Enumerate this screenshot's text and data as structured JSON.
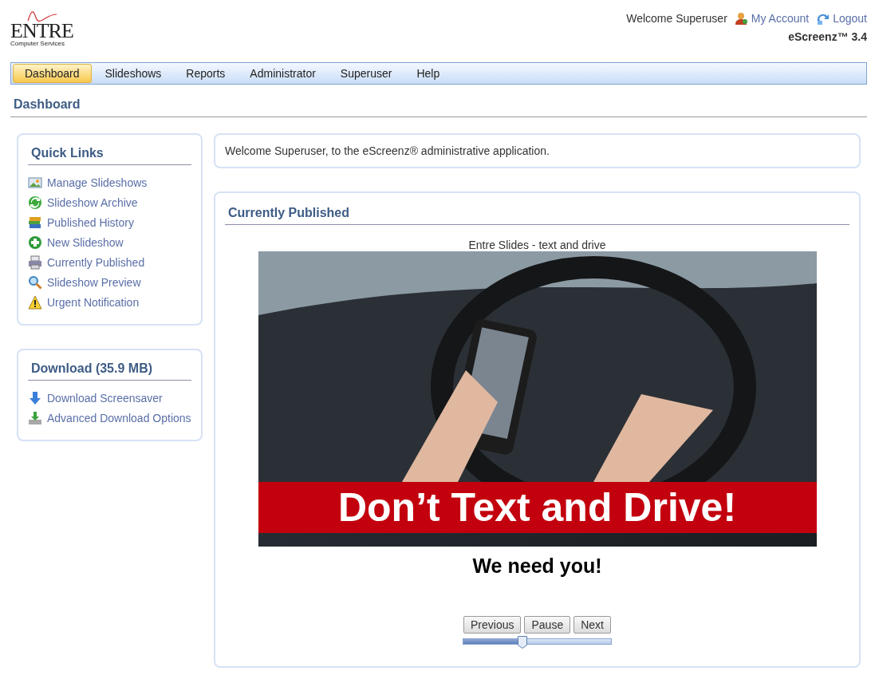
{
  "header": {
    "logo": {
      "name": "ENTRE",
      "subtitle": "Computer Services"
    },
    "welcome": "Welcome Superuser",
    "links": [
      {
        "kind": "account",
        "label": "My Account"
      },
      {
        "kind": "logout",
        "label": "Logout"
      }
    ],
    "version": "eScreenz™ 3.4"
  },
  "nav": [
    {
      "label": "Dashboard",
      "selected": true
    },
    {
      "label": "Slideshows",
      "selected": false
    },
    {
      "label": "Reports",
      "selected": false
    },
    {
      "label": "Administrator",
      "selected": false
    },
    {
      "label": "Superuser",
      "selected": false
    },
    {
      "label": "Help",
      "selected": false
    }
  ],
  "page_title": "Dashboard",
  "sidebar": [
    {
      "title": "Quick Links",
      "items": [
        {
          "kind": "picture",
          "label": "Manage Slideshows"
        },
        {
          "kind": "recycle",
          "label": "Slideshow Archive"
        },
        {
          "kind": "books",
          "label": "Published History"
        },
        {
          "kind": "plus",
          "label": "New Slideshow"
        },
        {
          "kind": "printer",
          "label": "Currently Published"
        },
        {
          "kind": "magnifier",
          "label": "Slideshow Preview"
        },
        {
          "kind": "warning",
          "label": "Urgent Notification"
        }
      ]
    },
    {
      "title": "Download (35.9 MB)",
      "items": [
        {
          "kind": "down",
          "label": "Download Screensaver"
        },
        {
          "kind": "install",
          "label": "Advanced Download Options"
        }
      ]
    }
  ],
  "welcome_message": "Welcome Superuser, to the eScreenz® administrative application.",
  "published": {
    "title": "Currently Published",
    "slide_title": "Entre Slides - text and drive",
    "banner": "Don’t Text and Drive!",
    "caption": "We need you!",
    "buttons": [
      "Previous",
      "Pause",
      "Next"
    ],
    "slider": {
      "level": 0.4
    }
  }
}
